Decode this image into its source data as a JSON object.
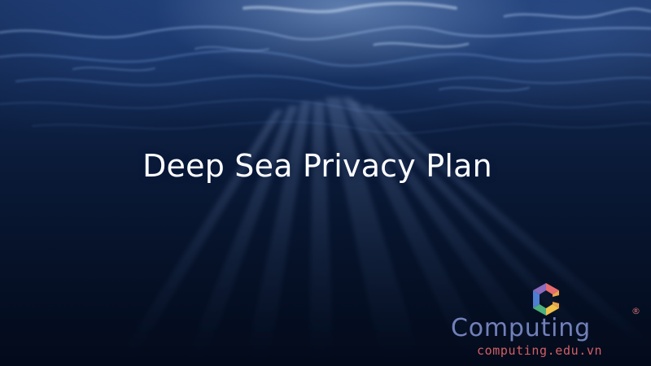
{
  "scene": {
    "title": "Deep Sea Privacy Plan",
    "watermark": {
      "brand": "Computing",
      "registered_mark": "®",
      "domain": "computing.edu.vn",
      "logo_icon": "computing-logo-icon"
    }
  },
  "colors": {
    "water_surface": "#1b3567",
    "deep_water": "#030a1a",
    "title_text": "#ffffff",
    "watermark_brand": "#7887c3",
    "watermark_domain": "#dc6469"
  }
}
